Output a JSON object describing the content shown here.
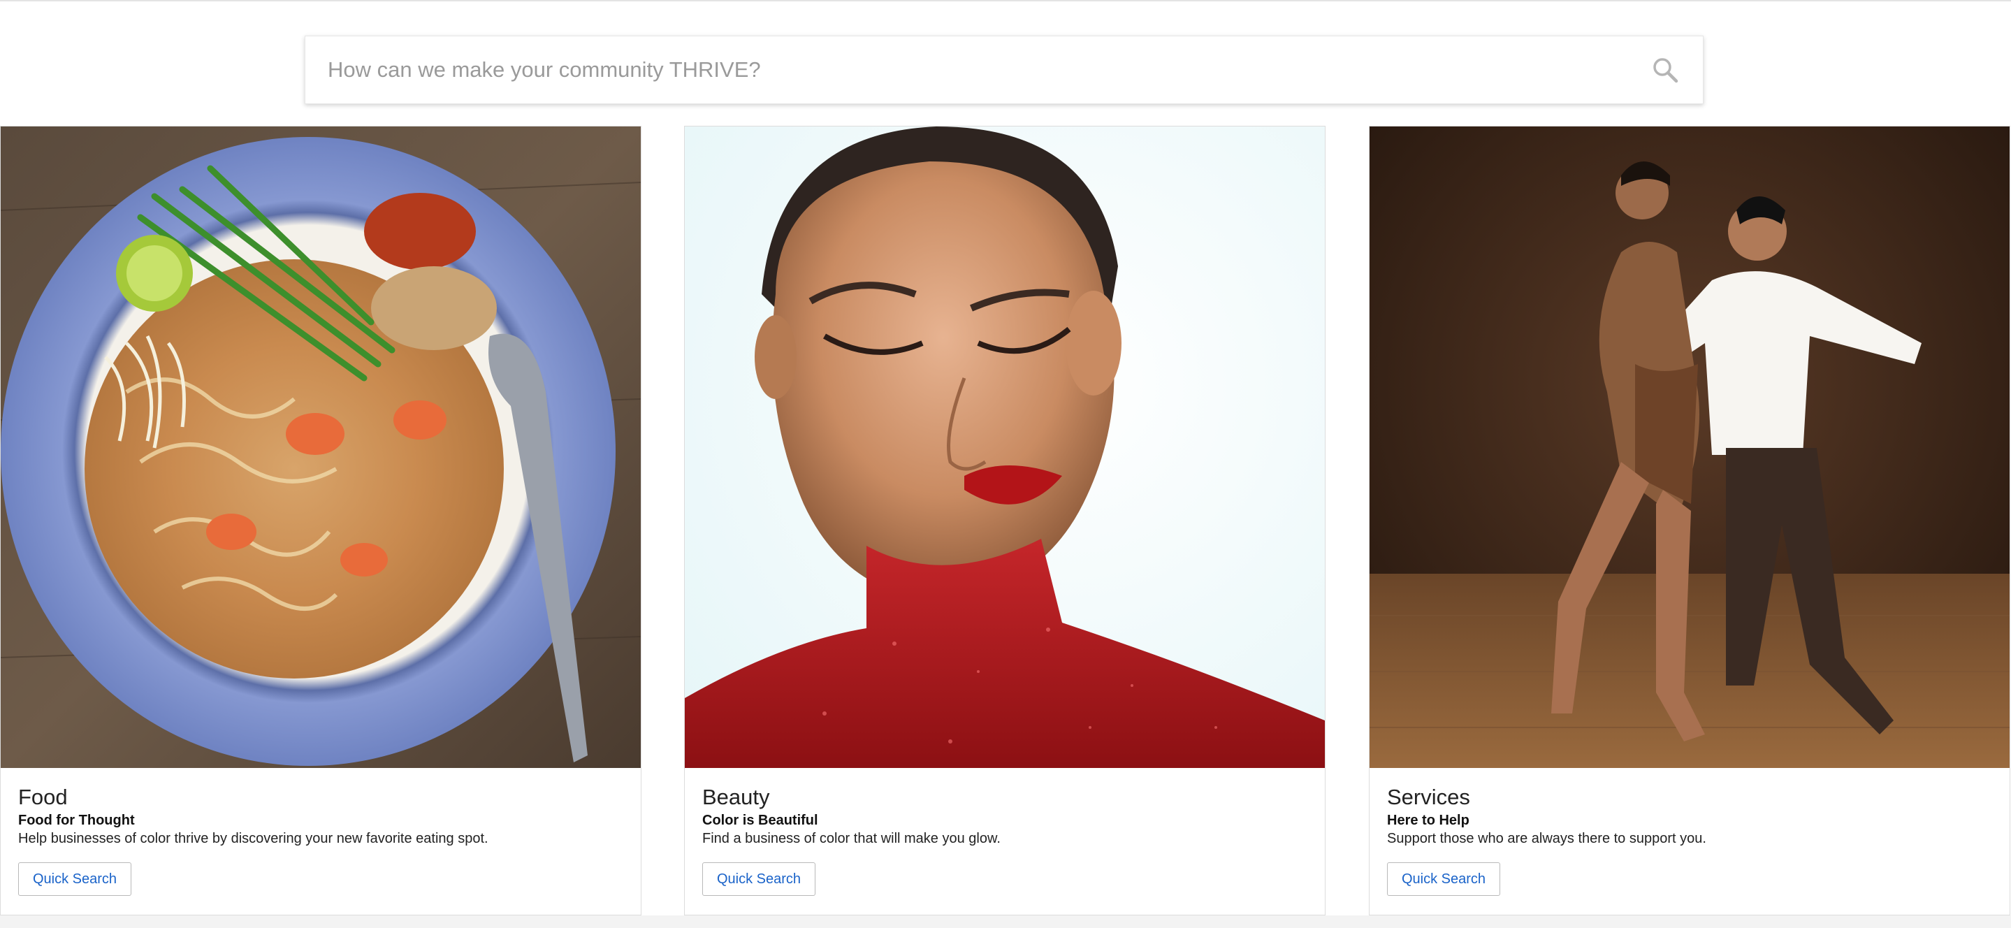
{
  "search": {
    "placeholder": "How can we make your community THRIVE?",
    "value": "",
    "icon": "search-icon"
  },
  "cards": [
    {
      "title": "Food",
      "subtitle": "Food for Thought",
      "description": "Help businesses of color thrive by discovering your new favorite eating spot.",
      "button_label": "Quick Search",
      "image": "pad-thai-plate-photo"
    },
    {
      "title": "Beauty",
      "subtitle": "Color is Beautiful",
      "description": "Find a business of color that will make you glow.",
      "button_label": "Quick Search",
      "image": "woman-red-glitter-photo"
    },
    {
      "title": "Services",
      "subtitle": "Here to Help",
      "description": "Support those who are always there to support you.",
      "button_label": "Quick Search",
      "image": "latin-dancers-photo"
    }
  ],
  "colors": {
    "link_blue": "#1a63c9",
    "card_border": "#dcdcdc",
    "plate_blue": "#7f93cc",
    "glitter_red": "#b41a1d",
    "stage_brown": "#3a2418"
  }
}
